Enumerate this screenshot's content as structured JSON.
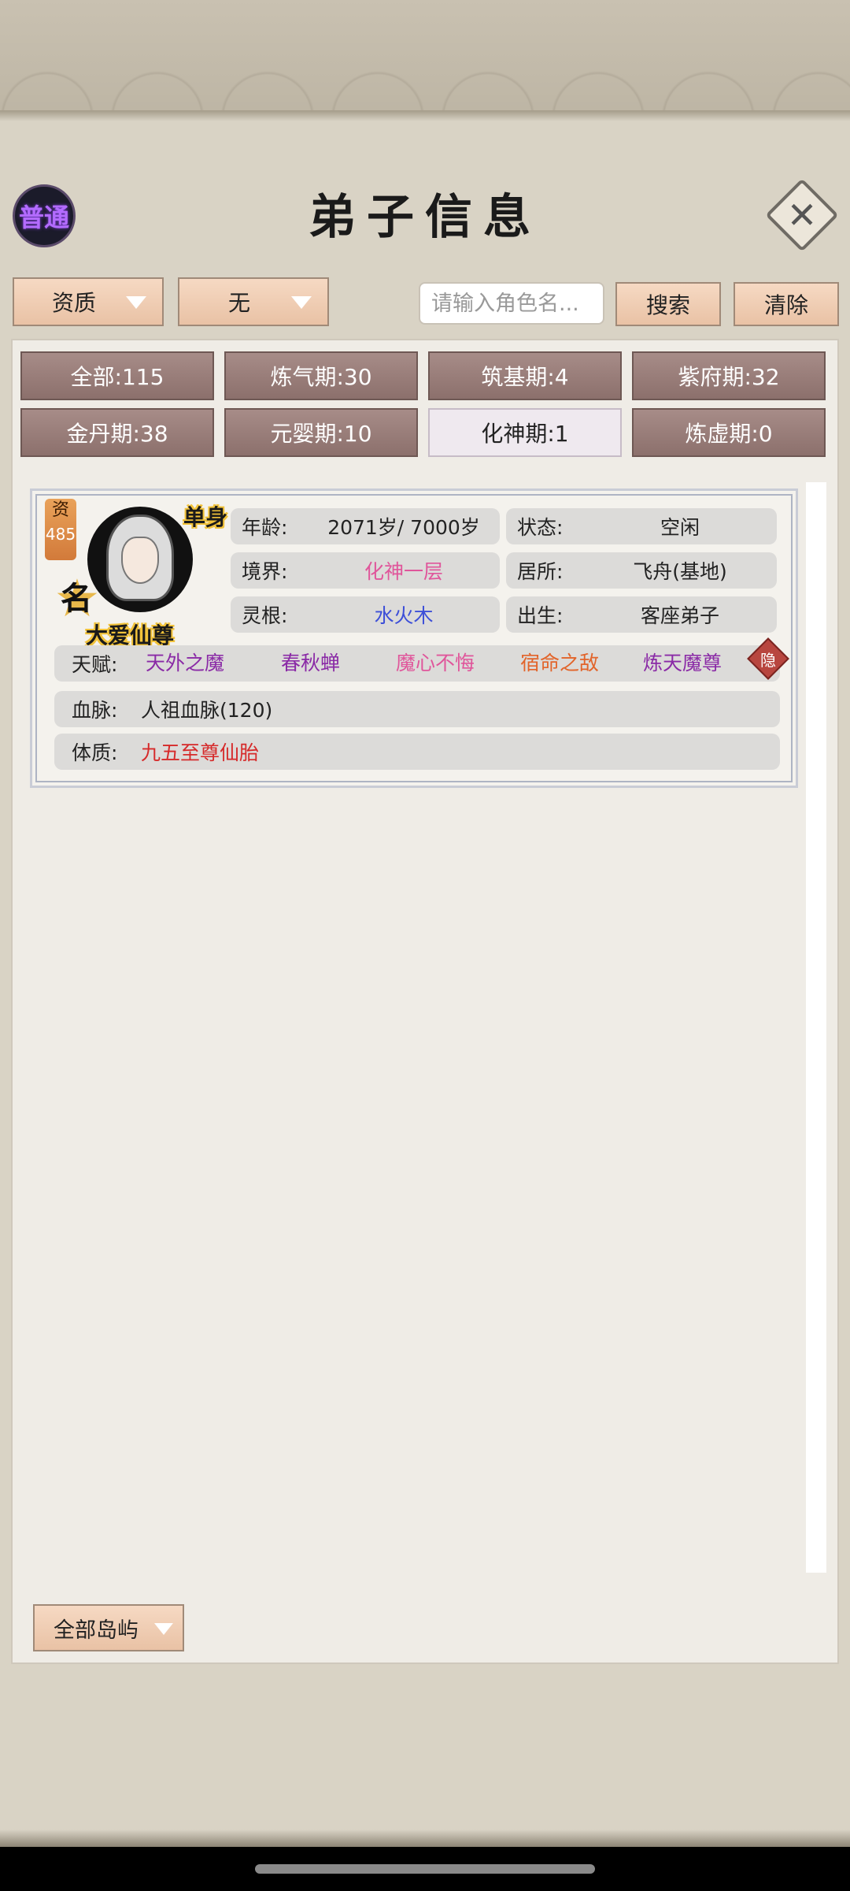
{
  "header": {
    "mode_badge": "普通",
    "title": "弟子信息",
    "close_icon": "close-icon"
  },
  "filters": {
    "sort_dropdown": "资质",
    "second_dropdown": "无",
    "search_placeholder": "请输入角色名...",
    "search_button": "搜索",
    "clear_button": "清除"
  },
  "tabs": [
    {
      "label": "全部:115",
      "active": false
    },
    {
      "label": "炼气期:30",
      "active": false
    },
    {
      "label": "筑基期:4",
      "active": false
    },
    {
      "label": "紫府期:32",
      "active": false
    },
    {
      "label": "金丹期:38",
      "active": false
    },
    {
      "label": "元婴期:10",
      "active": false
    },
    {
      "label": "化神期:1",
      "active": true
    },
    {
      "label": "炼虚期:0",
      "active": false
    }
  ],
  "disciple": {
    "qualification_label": "资",
    "qualification_value": "485",
    "fame_char": "名",
    "single_tag": "单身",
    "title": "大爱仙尊",
    "age_key": "年龄:",
    "age_value": "2071岁/ 7000岁",
    "status_key": "状态:",
    "status_value": "空闲",
    "realm_key": "境界:",
    "realm_value": "化神一层",
    "residence_key": "居所:",
    "residence_value": "飞舟(基地)",
    "root_key": "灵根:",
    "root_value": "水火木",
    "origin_key": "出生:",
    "origin_value": "客座弟子",
    "talent_key": "天赋:",
    "talents": [
      "天外之魔",
      "春秋蝉",
      "魔心不悔",
      "宿命之敌",
      "炼天魔尊"
    ],
    "hide_label": "隐",
    "bloodline_key": "血脉:",
    "bloodline_value": "人祖血脉(120)",
    "constitution_key": "体质:",
    "constitution_value": "九五至尊仙胎"
  },
  "footer": {
    "island_dropdown": "全部岛屿"
  },
  "colors": {
    "realm": "#e0569b",
    "root": "#3d4fd8",
    "talent_purple": "#8a2aa6",
    "talent_pink": "#e0569b",
    "talent_orange": "#e2642a",
    "constitution": "#d62a2a",
    "button_peach": "#f2d0b6",
    "tab_brown": "#9a7e7a"
  }
}
